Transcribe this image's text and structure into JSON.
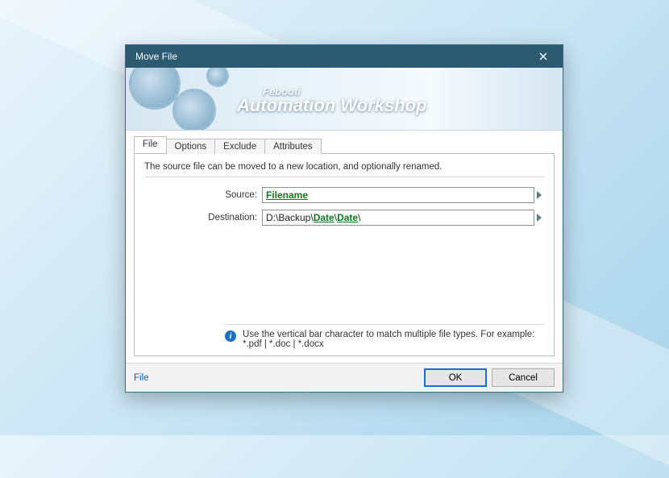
{
  "window": {
    "title": "Move File"
  },
  "banner": {
    "brand_small": "Febooti",
    "brand_big": "Automation Workshop"
  },
  "tabs": [
    "File",
    "Options",
    "Exclude",
    "Attributes"
  ],
  "panel": {
    "description": "The source file can be moved to a new location, and optionally renamed.",
    "source_label": "Source:",
    "destination_label": "Destination:",
    "source_value_var": "Filename",
    "dest_prefix": "D:\\Backup\\",
    "dest_var1": "Date",
    "dest_sep1": "\\",
    "dest_var2": "Date",
    "dest_suffix": "\\",
    "hint_line1": "Use the vertical bar character to match multiple file types. For example:",
    "hint_line2": "*.pdf  |  *.doc  |  *.docx"
  },
  "footer": {
    "status": "File",
    "ok": "OK",
    "cancel": "Cancel"
  }
}
